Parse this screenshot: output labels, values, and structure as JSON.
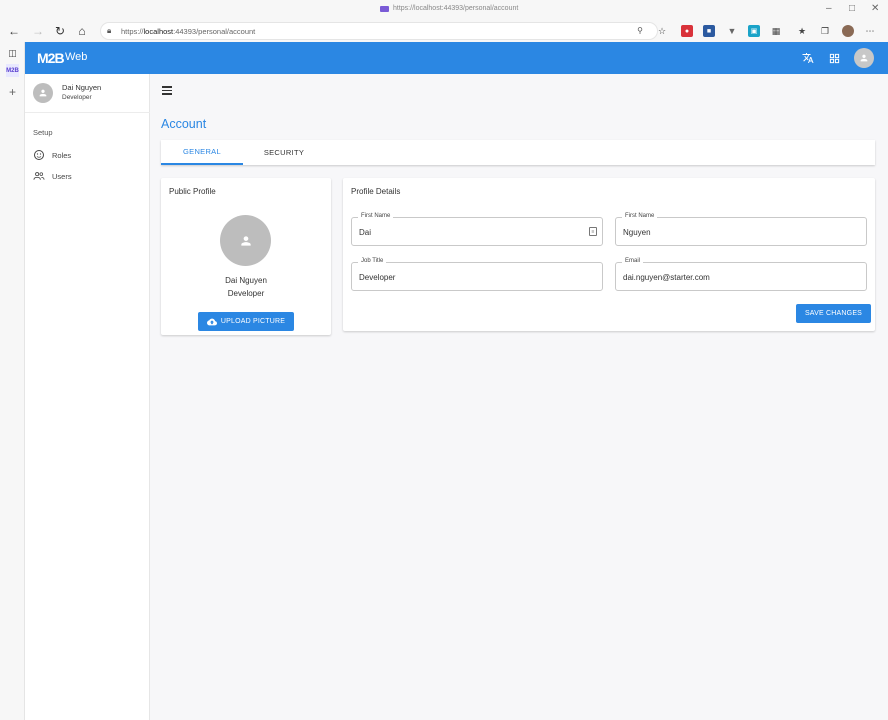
{
  "browser": {
    "tab_title": "https://localhost:44393/personal/account",
    "url_prefix": "https://",
    "url_host": "localhost",
    "url_rest": ":44393/personal/account"
  },
  "app": {
    "logo": "M2B",
    "brand": "Web"
  },
  "sidebar": {
    "user_name": "Dai Nguyen",
    "user_role": "Developer",
    "section": "Setup",
    "items": [
      {
        "label": "Roles",
        "icon": "face-icon"
      },
      {
        "label": "Users",
        "icon": "users-icon"
      }
    ]
  },
  "main": {
    "page_title": "Account",
    "tabs": [
      {
        "label": "GENERAL",
        "active": true
      },
      {
        "label": "SECURITY",
        "active": false
      }
    ],
    "public_profile": {
      "title": "Public Profile",
      "name": "Dai Nguyen",
      "role": "Developer",
      "upload_label": "UPLOAD PICTURE"
    },
    "profile_details": {
      "title": "Profile Details",
      "fields": [
        {
          "label": "First Name",
          "value": "Dai"
        },
        {
          "label": "First Name",
          "value": "Nguyen"
        },
        {
          "label": "Job Title",
          "value": "Developer"
        },
        {
          "label": "Email",
          "value": "dai.nguyen@starter.com"
        }
      ],
      "save_label": "SAVE CHANGES"
    }
  },
  "colors": {
    "primary": "#2b87e3",
    "avatar_bg": "#bdbdbd"
  }
}
